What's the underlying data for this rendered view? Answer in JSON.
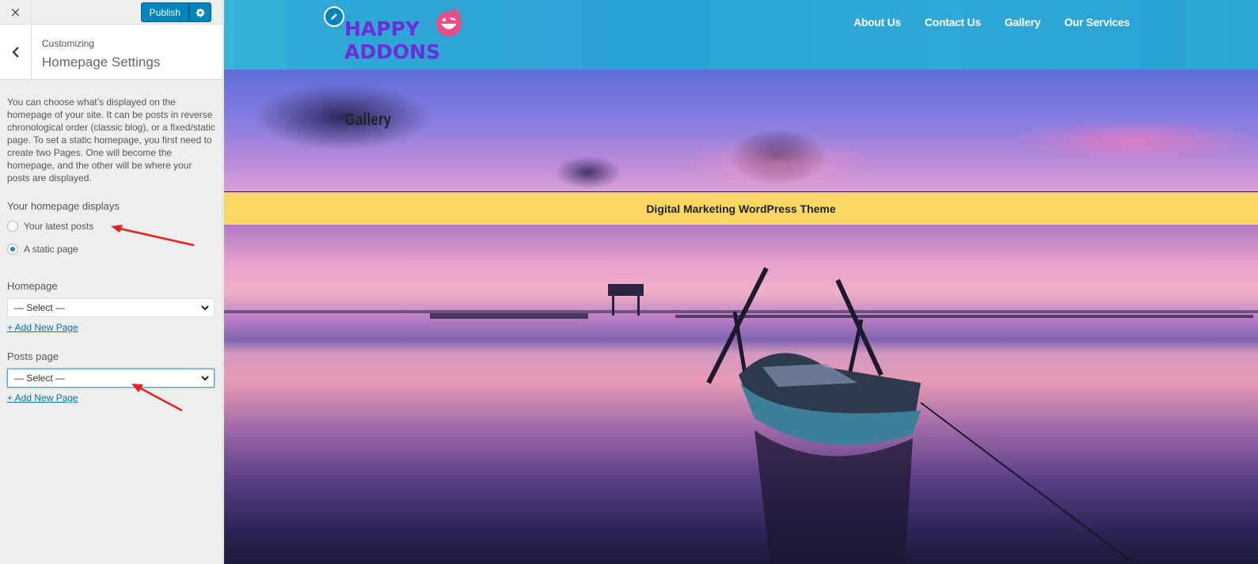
{
  "sidebar": {
    "close_label": "×",
    "publish_label": "Publish",
    "breadcrumb": "Customizing",
    "section_title": "Homepage Settings",
    "description": "You can choose what’s displayed on the homepage of your site. It can be posts in reverse chronological order (classic blog), or a fixed/static page. To set a static homepage, you first need to create two Pages. One will become the homepage, and the other will be where your posts are displayed.",
    "homepage_displays": {
      "label": "Your homepage displays",
      "options": [
        {
          "label": "Your latest posts",
          "checked": false
        },
        {
          "label": "A static page",
          "checked": true
        }
      ]
    },
    "homepage": {
      "label": "Homepage",
      "selected": "— Select —",
      "add_link": "+ Add New Page"
    },
    "posts_page": {
      "label": "Posts page",
      "selected": "— Select —",
      "add_link": "+ Add New Page"
    }
  },
  "preview": {
    "logo_line1": "HAPPY",
    "logo_line2": "ADDONS",
    "nav": [
      "About Us",
      "Contact Us",
      "Gallery",
      "Our Services"
    ],
    "hero_title": "Gallery",
    "banner_text": "Digital Marketing WordPress Theme"
  },
  "colors": {
    "accent": "#0085ba",
    "link": "#0073aa",
    "banner": "#fbd764",
    "logo_purple": "#6a2fd6",
    "logo_pink": "#e94e84",
    "annotation_arrow": "#e8201f"
  }
}
